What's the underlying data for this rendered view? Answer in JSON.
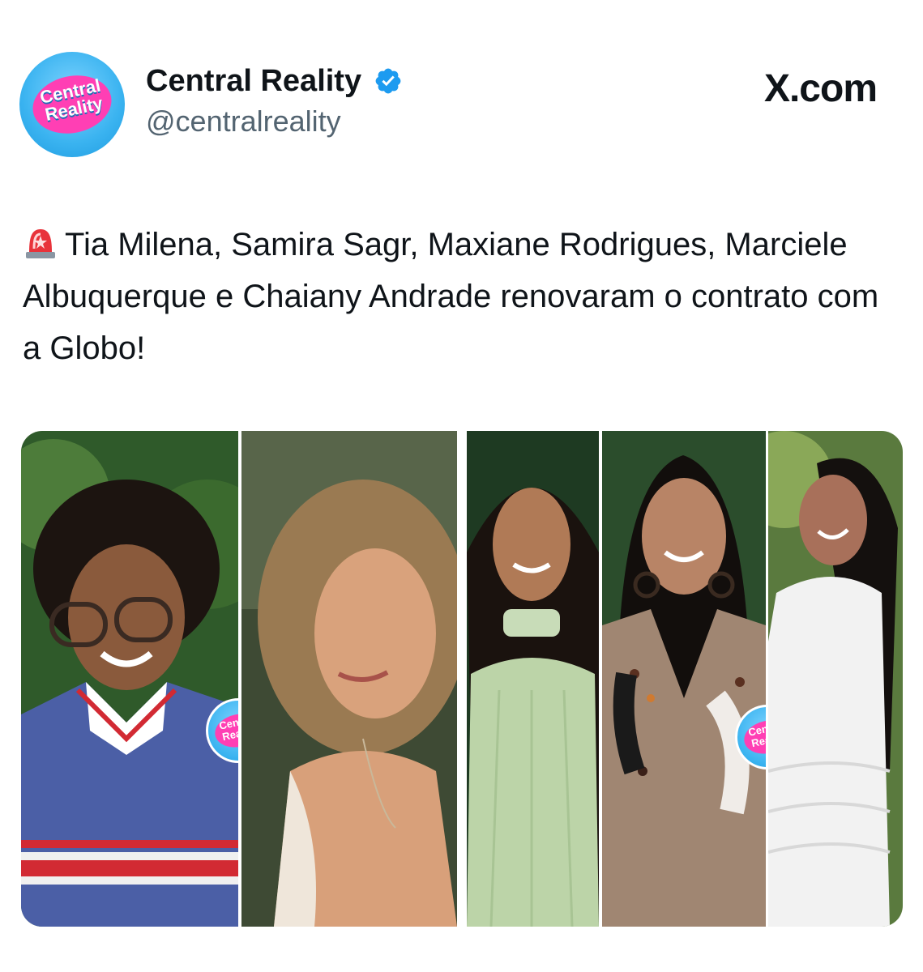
{
  "account": {
    "display_name": "Central Reality",
    "handle": "@centralreality",
    "avatar_text": "Central Reality",
    "verified": true
  },
  "brand": {
    "label": "X.com"
  },
  "tweet": {
    "emoji": "siren-icon",
    "text": "Tia Milena, Samira Sagr, Maxiane Rodrigues, Marciele Albuquerque e Chaiany Andrade renovaram o contrato com a Globo!"
  },
  "photos": {
    "watermark_text": "Central Reality",
    "count": 5
  },
  "colors": {
    "text": "#0f1419",
    "secondary": "#536471",
    "verified": "#1d9bf0",
    "brand_pink": "#ff3fb4",
    "brand_blue": "#3ab3f0"
  }
}
